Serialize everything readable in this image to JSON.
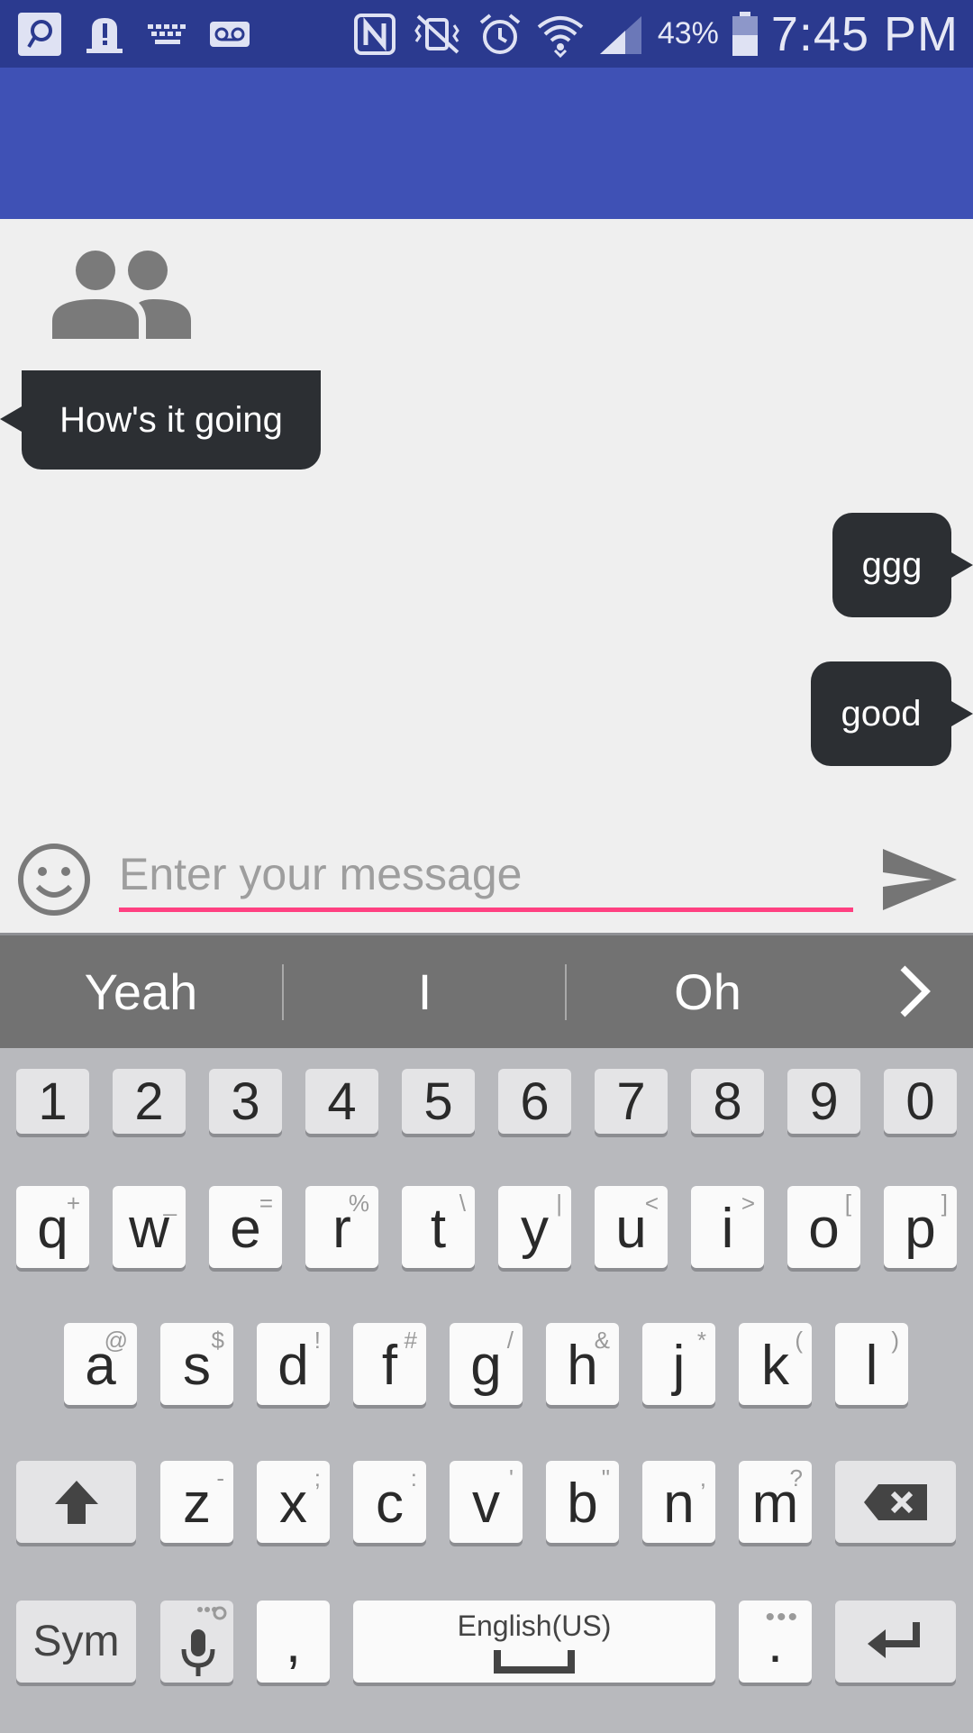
{
  "status_bar": {
    "battery": "43%",
    "time": "7:45 PM",
    "icons": [
      "app-notification-icon",
      "alert-icon",
      "keyboard-icon",
      "voicemail-icon",
      "nfc-icon",
      "vibrate-mute-icon",
      "alarm-icon",
      "wifi-icon",
      "signal-icon",
      "battery-icon"
    ]
  },
  "conversation": {
    "incoming_message": "How's it going",
    "outgoing_messages": [
      "ggg",
      "good"
    ]
  },
  "composer": {
    "placeholder": "Enter your message"
  },
  "keyboard": {
    "suggestions": [
      "Yeah",
      "I",
      "Oh"
    ],
    "number_row": [
      "1",
      "2",
      "3",
      "4",
      "5",
      "6",
      "7",
      "8",
      "9",
      "0"
    ],
    "row1": [
      {
        "key": "q",
        "hint": "+"
      },
      {
        "key": "w",
        "hint": "_"
      },
      {
        "key": "e",
        "hint": "="
      },
      {
        "key": "r",
        "hint": "%"
      },
      {
        "key": "t",
        "hint": "\\"
      },
      {
        "key": "y",
        "hint": "|"
      },
      {
        "key": "u",
        "hint": "<"
      },
      {
        "key": "i",
        "hint": ">"
      },
      {
        "key": "o",
        "hint": "["
      },
      {
        "key": "p",
        "hint": "]"
      }
    ],
    "row2": [
      {
        "key": "a",
        "hint": "@"
      },
      {
        "key": "s",
        "hint": "$"
      },
      {
        "key": "d",
        "hint": "!"
      },
      {
        "key": "f",
        "hint": "#"
      },
      {
        "key": "g",
        "hint": "/"
      },
      {
        "key": "h",
        "hint": "&"
      },
      {
        "key": "j",
        "hint": "*"
      },
      {
        "key": "k",
        "hint": "("
      },
      {
        "key": "l",
        "hint": ")"
      }
    ],
    "row3": [
      {
        "key": "z",
        "hint": "-"
      },
      {
        "key": "x",
        "hint": ";"
      },
      {
        "key": "c",
        "hint": ":"
      },
      {
        "key": "v",
        "hint": "'"
      },
      {
        "key": "b",
        "hint": "\""
      },
      {
        "key": "n",
        "hint": ","
      },
      {
        "key": "m",
        "hint": "?"
      }
    ],
    "sym_label": "Sym",
    "comma": ",",
    "period": ".",
    "space_label": "English(US)"
  },
  "colors": {
    "status_bar": "#2b3a8f",
    "app_bar": "#3f51b5",
    "accent": "#ff4081",
    "bubble": "#2c2f33"
  }
}
